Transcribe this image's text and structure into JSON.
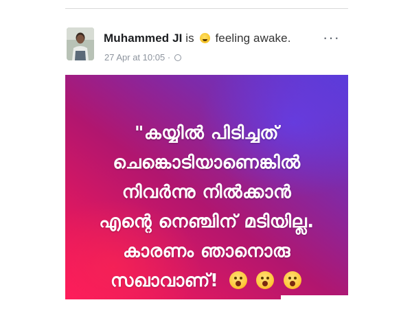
{
  "post": {
    "author": "Muhammed JI",
    "is_text": "is",
    "feeling_emoji": "smiling-face-icon",
    "feeling_text": "feeling awake.",
    "timestamp": "27 Apr at 10:05",
    "separator": "·",
    "privacy_icon": "globe-icon",
    "more_label": "···",
    "body_lines": [
      "\"കയ്യിൽ പിടിച്ചത്",
      "ചെങ്കൊടിയാണെങ്കിൽ",
      "നിവർന്നു നിൽക്കാൻ",
      "എന്റെ നെഞ്ചിന് മടിയില്ല.",
      "കാരണം ഞാനൊരു",
      "സഖാവാണ്!"
    ],
    "emojis": [
      "astonished-face-icon",
      "astonished-face-icon",
      "astonished-face-icon"
    ]
  },
  "colors": {
    "background_gradient": [
      "#ff1a5c",
      "#b1166f",
      "#5a3bd8"
    ],
    "text": "#ffffff"
  }
}
